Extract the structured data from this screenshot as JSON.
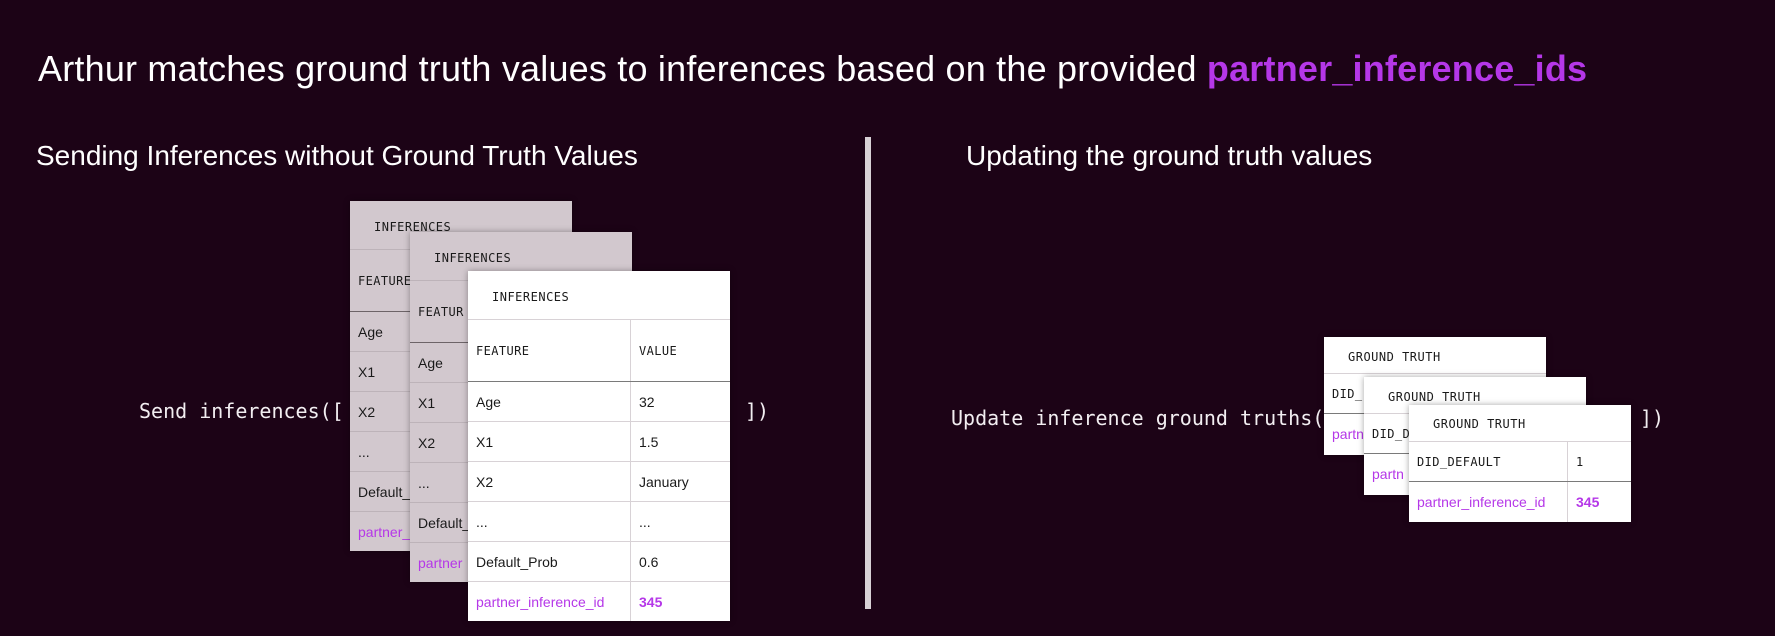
{
  "headline": {
    "text": "Arthur matches ground truth values to inferences based on the provided ",
    "highlight": "partner_inference_ids"
  },
  "left": {
    "title": "Sending Inferences without Ground Truth Values",
    "code_prefix": "Send inferences([",
    "code_suffix": "])",
    "card_title": "INFERENCES",
    "headers": [
      "FEATURE",
      "VALUE"
    ],
    "rows": [
      {
        "feature": "Age",
        "value": "32"
      },
      {
        "feature": "X1",
        "value": "1.5"
      },
      {
        "feature": "X2",
        "value": "January"
      },
      {
        "feature": "...",
        "value": "..."
      },
      {
        "feature": "Default_Prob",
        "value": "0.6"
      },
      {
        "feature": "partner_inference_id",
        "value": "345"
      }
    ],
    "back_rows": [
      "Age",
      "X1",
      "X2",
      "...",
      "Default_",
      "partner_"
    ],
    "middle_rows": [
      "Age",
      "X1",
      "X2",
      "...",
      "Default_",
      "partner"
    ],
    "back_header": "FEATURE",
    "middle_header": "FEATUR"
  },
  "right": {
    "title": "Updating the ground truth values",
    "code_prefix": "Update inference ground truths([",
    "code_suffix": "])",
    "card_title": "GROUND TRUTH",
    "rows": [
      {
        "feature": "DID_DEFAULT",
        "value": "1"
      },
      {
        "feature": "partner_inference_id",
        "value": "345"
      }
    ],
    "back_rows": [
      "DID_",
      "partn"
    ],
    "middle_rows": [
      "DID_D",
      "partn"
    ]
  },
  "colors": {
    "background": "#1c0316",
    "accent": "#b537e8",
    "back_card": "#d2c8ce"
  }
}
